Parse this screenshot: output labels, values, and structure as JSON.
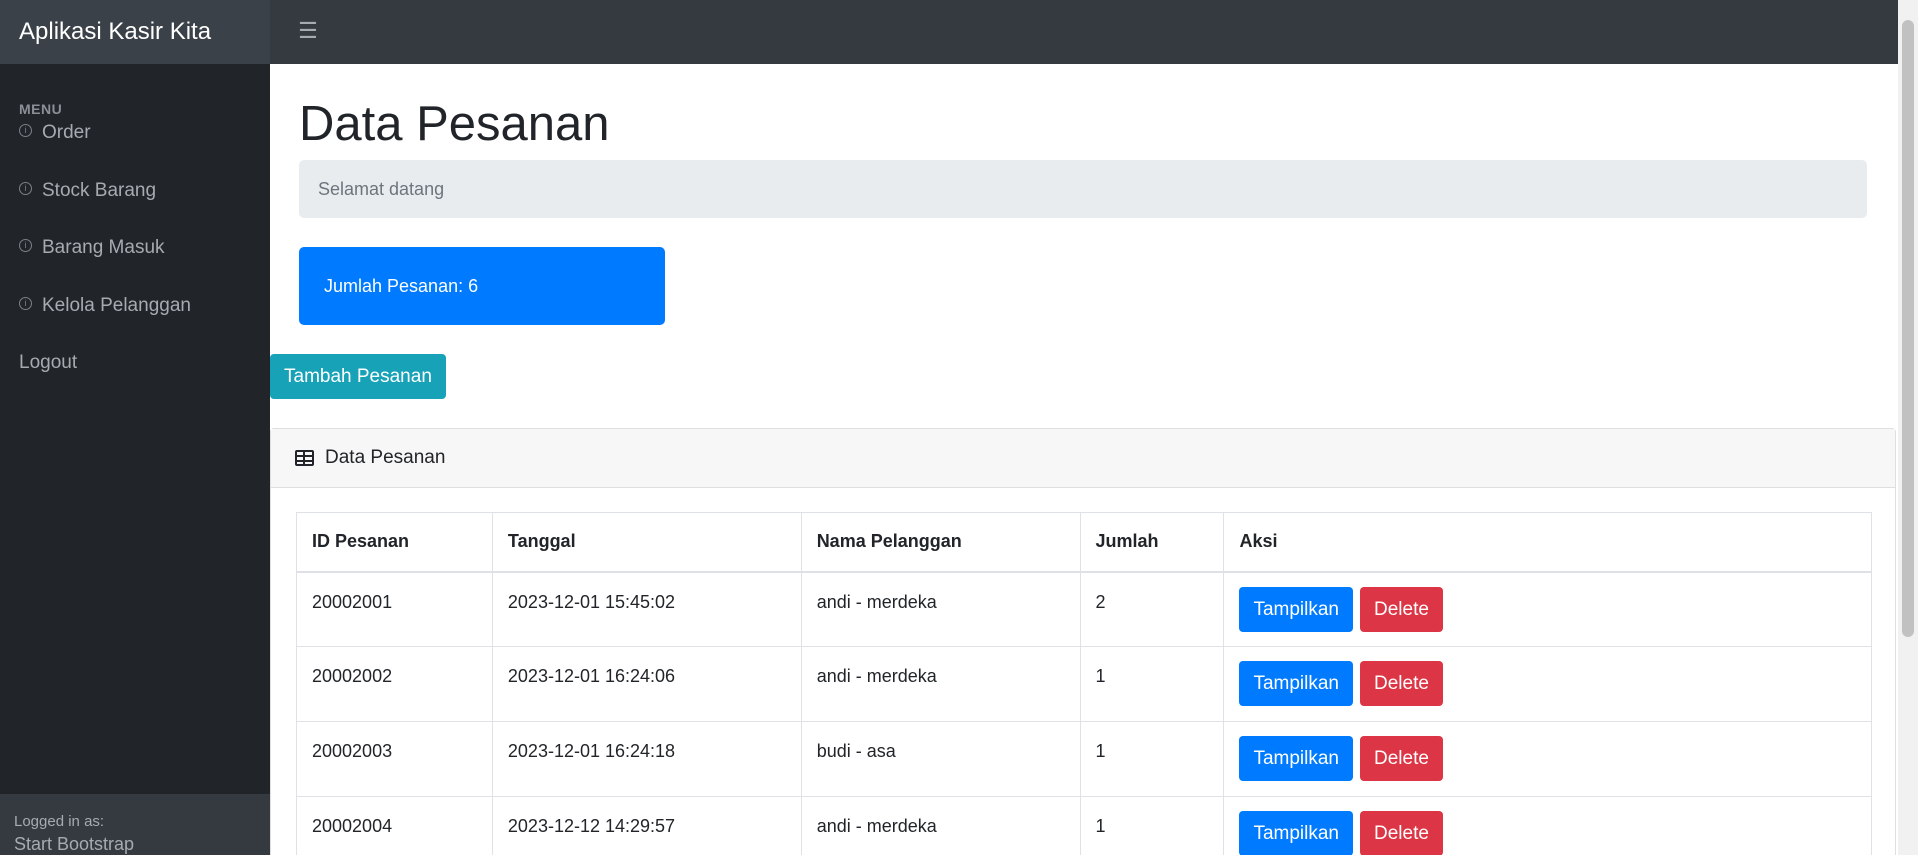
{
  "app": {
    "brand": "Aplikasi Kasir Kita",
    "toggle_icon": "menu-icon"
  },
  "sidebar": {
    "heading": "MENU",
    "items": [
      {
        "label": "Order",
        "icon": "info-circle-icon"
      },
      {
        "label": "Stock Barang",
        "icon": "info-circle-icon"
      },
      {
        "label": "Barang Masuk",
        "icon": "info-circle-icon"
      },
      {
        "label": "Kelola Pelanggan",
        "icon": "info-circle-icon"
      }
    ],
    "logout": "Logout",
    "footer": {
      "label": "Logged in as:",
      "name": "Start Bootstrap"
    }
  },
  "main": {
    "title": "Data Pesanan",
    "breadcrumb": "Selamat datang",
    "stat": {
      "label": "Jumlah Pesanan: 6"
    },
    "add_button": "Tambah Pesanan",
    "card_title": "Data Pesanan",
    "table": {
      "headers": [
        "ID Pesanan",
        "Tanggal",
        "Nama Pelanggan",
        "Jumlah",
        "Aksi"
      ],
      "rows": [
        {
          "id": "20002001",
          "tanggal": "2023-12-01 15:45:02",
          "nama": "andi - merdeka",
          "jumlah": "2"
        },
        {
          "id": "20002002",
          "tanggal": "2023-12-01 16:24:06",
          "nama": "andi - merdeka",
          "jumlah": "1"
        },
        {
          "id": "20002003",
          "tanggal": "2023-12-01 16:24:18",
          "nama": "budi - asa",
          "jumlah": "1"
        },
        {
          "id": "20002004",
          "tanggal": "2023-12-12 14:29:57",
          "nama": "andi - merdeka",
          "jumlah": "1"
        }
      ],
      "show_label": "Tampilkan",
      "delete_label": "Delete"
    }
  },
  "colors": {
    "primary": "#007bff",
    "danger": "#dc3545",
    "info": "#17a2b8",
    "sidebar": "#212529",
    "topbar": "#343a40"
  }
}
